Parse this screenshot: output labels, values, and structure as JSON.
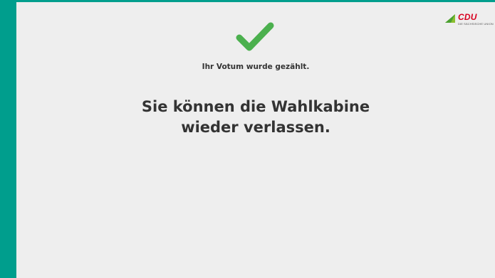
{
  "logo": {
    "text": "CDU",
    "subtitle": "DIE SÄCHSISCHE UNION"
  },
  "icons": {
    "check": "checkmark-icon"
  },
  "colors": {
    "frame": "#009e8d",
    "screen": "#eeeeee",
    "check": "#4bb04e",
    "logo_red": "#d8001f",
    "text": "#333333"
  },
  "main": {
    "confirmation": "Ihr Votum wurde gezählt.",
    "message_line1": "Sie können die Wahlkabine",
    "message_line2": "wieder verlassen."
  }
}
